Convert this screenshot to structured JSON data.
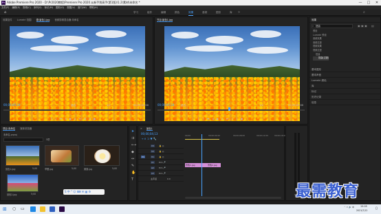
{
  "window": {
    "title": "Adobe Premiere Pro 2020 - D:\\Pr2020教程\\Premiere Pro 2020 从新手到高手(第1版)\\1.2\\素材\\未命名 *",
    "minimize": "—",
    "maximize": "□",
    "close": "✕"
  },
  "menu": [
    "文件(F)",
    "编辑(E)",
    "剪辑(C)",
    "序列(S)",
    "标记(M)",
    "图形(G)",
    "视图(V)",
    "窗口(W)",
    "帮助(H)"
  ],
  "workspaces": [
    "学习",
    "组件",
    "编辑",
    "颜色",
    "效果",
    "音频",
    "图形",
    "库"
  ],
  "workspaces_active": "效果",
  "source_panel": {
    "tabs": [
      "效果控件",
      "Lumetri 范围",
      "源:景色1.jpg",
      "音频剪辑混合器:未命名"
    ],
    "active_tab": "源:景色1.jpg",
    "timecode_left": "00;00;04;24",
    "fit": "适合",
    "fraction": "1/2",
    "timecode_right": "00;00;05;00"
  },
  "program_panel": {
    "tab": "节目:景色1.jpg",
    "timecode_left": "00;00;04;24",
    "fit": "适合",
    "fraction": "1/2",
    "timecode_right": "00;00;05;00"
  },
  "effects_panel": {
    "title": "效果",
    "search_value": "扭曲",
    "tree": [
      "预设",
      "Lumetri 预设",
      "音频效果",
      "音频过渡",
      "视频效果",
      "视频过渡",
      "扭曲",
      "扭曲(过渡)"
    ],
    "sections": [
      "基本图形",
      "基本声音",
      "Lumetri 颜色",
      "库",
      "标记",
      "历史记录",
      "信息"
    ]
  },
  "project_panel": {
    "tabs": [
      "项目:未命名",
      "媒体浏览器"
    ],
    "path": "未命名.prproj",
    "count": "5项",
    "items": [
      {
        "name": "景色1.jpg",
        "dur": "5;00"
      },
      {
        "name": "早餐.jpg",
        "dur": "5;00"
      },
      {
        "name": "美食.jpg",
        "dur": "5;00"
      },
      {
        "name": "景色2.jpg",
        "dur": "5;00"
      }
    ]
  },
  "timeline": {
    "tab": "景色1",
    "timecode": "00;00;04;13",
    "ruler": [
      "00;00",
      "00;00;04;00",
      "00;00;08;00",
      "00;00;12;00",
      "00;00;16;00"
    ],
    "video_tracks": [
      "V3",
      "V2",
      "V1"
    ],
    "audio_tracks": [
      "A1",
      "A2",
      "A3"
    ],
    "master": "主声道",
    "master_value": "0.0",
    "clip1": "景色1.jpg",
    "clip2": "景色2.jpg"
  },
  "taskbar": {
    "time": "15:05",
    "date": "2021/7/12"
  },
  "watermark": "最需教育",
  "colors": {
    "accent": "#4aa3ff",
    "clip_pink": "#d58fd8",
    "clip_yellow": "#d9c44a"
  }
}
